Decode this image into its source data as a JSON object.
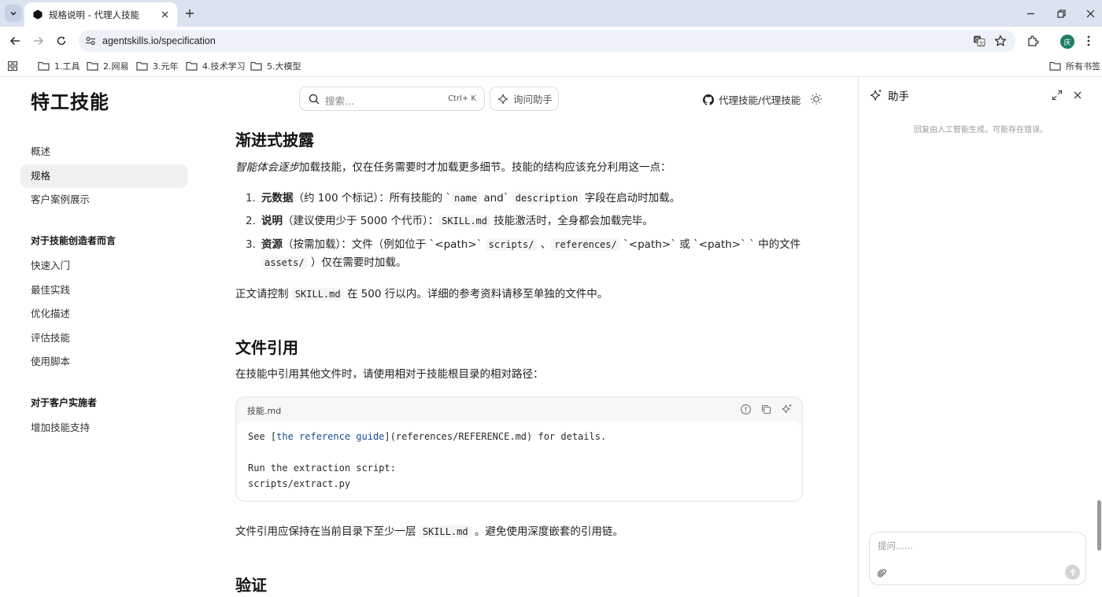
{
  "browser": {
    "tab_title": "规格说明 - 代理人技能",
    "url": "agentskills.io/specification",
    "avatar_letter": "庆",
    "bookmarks": [
      "1.工具",
      "2.网易",
      "3.元年",
      "4.技术学习",
      "5.大模型"
    ],
    "all_bookmarks": "所有书签"
  },
  "site": {
    "brand": "特工技能",
    "search_placeholder": "搜索...",
    "search_shortcut": "Ctrl+ K",
    "ask_label": "询问助手",
    "github_label": "代理技能/代理技能"
  },
  "sidebar": {
    "items": [
      "概述",
      "规格",
      "客户案例展示"
    ],
    "active": "规格",
    "group1_title": "对于技能创造者而言",
    "group1_items": [
      "快速入门",
      "最佳实践",
      "优化描述",
      "评估技能",
      "使用脚本"
    ],
    "group2_title": "对于客户实施者",
    "group2_items": [
      "增加技能支持"
    ]
  },
  "content": {
    "h_progressive": "渐进式披露",
    "intro_italic": "智能体会逐步",
    "intro_rest": "加载技能，仅在任务需要时才加载更多细节。技能的结构应该充分利用这一点：",
    "list": [
      {
        "num": "1.",
        "bold": "元数据",
        "t1": "（约 100 个标记）：所有技能的 `",
        "c1": "name",
        "t2": " and` ",
        "c2": "description",
        "t3": " 字段在启动时加载。"
      },
      {
        "num": "2.",
        "bold": "说明",
        "t1": "（建议使用少于 5000 个代币）：",
        "c1": "SKILL.md",
        "t2": " 技能激活时，全身都会加载完毕。"
      },
      {
        "num": "3.",
        "bold": "资源",
        "t1": "（按需加载）：文件（例如位于 `<path>` ",
        "c1": "scripts/",
        "t2": " 、",
        "c2": "references/",
        "t3": " `<path>` 或 `<path>` ` 中的文件",
        "c3": "assets/",
        "t4": " ）仅在需要时加载。"
      }
    ],
    "body_pre": "正文请控制 ",
    "body_code": "SKILL.md",
    "body_post": " 在 500 行以内。详细的参考资料请移至单独的文件中。",
    "h_refs": "文件引用",
    "refs_intro": "在技能中引用其他文件时，请使用相对于技能根目录的相对路径：",
    "code_file": "技能.md",
    "code_lines": {
      "l1_a": "See [",
      "l1_link": "the reference guide",
      "l1_b": "](references/REFERENCE.md) for details.",
      "l3": "Run the extraction script:",
      "l4": "scripts/extract.py"
    },
    "refs_note_pre": "文件引用应保持在当前目录下至少一层 ",
    "refs_note_code": "SKILL.md",
    "refs_note_post": " 。避免使用深度嵌套的引用链。",
    "h_validate": "验证"
  },
  "assistant": {
    "title": "助手",
    "disclaimer": "回复由人工智能生成，可能存在错误。",
    "input_placeholder": "提问......"
  }
}
